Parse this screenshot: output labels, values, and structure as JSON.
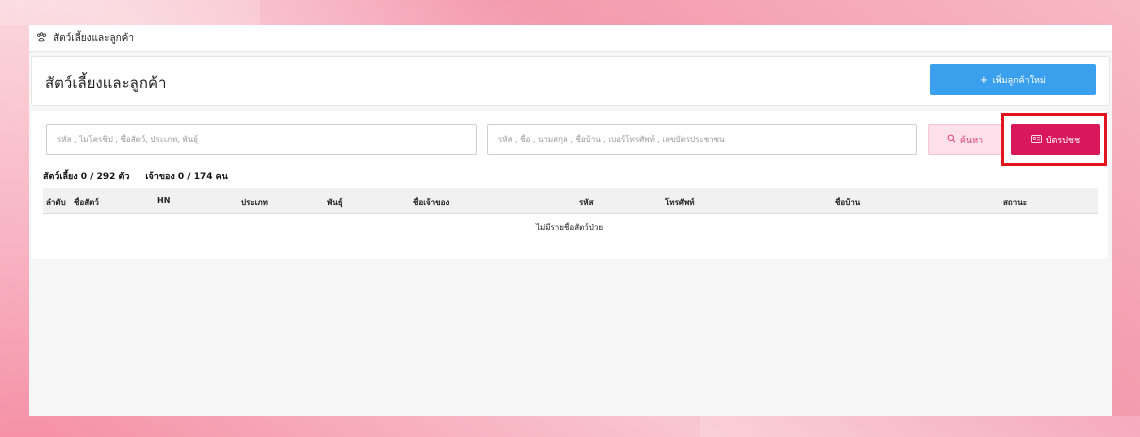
{
  "breadcrumb": {
    "icon": "paw-icon",
    "label": "สัตว์เลี้ยงและลูกค้า"
  },
  "header": {
    "title": "สัตว์เลี้ยงและลูกค้า",
    "add_button_label": "เพิ่มลูกค้าใหม่"
  },
  "search": {
    "pet_placeholder": "รหัส , ไมโครชิป , ชื่อสัตว์, ประเภท, พันธุ์",
    "owner_placeholder": "รหัส , ชื่อ , นามสกุล , ชื่อบ้าน , เบอร์โทรศัพท์ , เลขบัตรประชาชน",
    "search_button_label": "ค้นหา",
    "id_card_button_label": "บัตรปชช"
  },
  "stats": {
    "pets": "สัตว์เลี้ยง 0 / 292 ตัว",
    "owners": "เจ้าของ 0 / 174 คน"
  },
  "table": {
    "columns": [
      "ลำดับ",
      "ชื่อสัตว์",
      "HN",
      "ประเภท",
      "พันธุ์",
      "ชื่อเจ้าของ",
      "รหัส",
      "โทรศัพท์",
      "ชื่อบ้าน",
      "สถานะ"
    ],
    "empty_message": "ไม่มีรายชื่อสัตว์ป่วย"
  },
  "colors": {
    "primary_blue": "#3aa0ee",
    "accent_pink": "#d9185c",
    "highlight_red": "#e3141b"
  }
}
